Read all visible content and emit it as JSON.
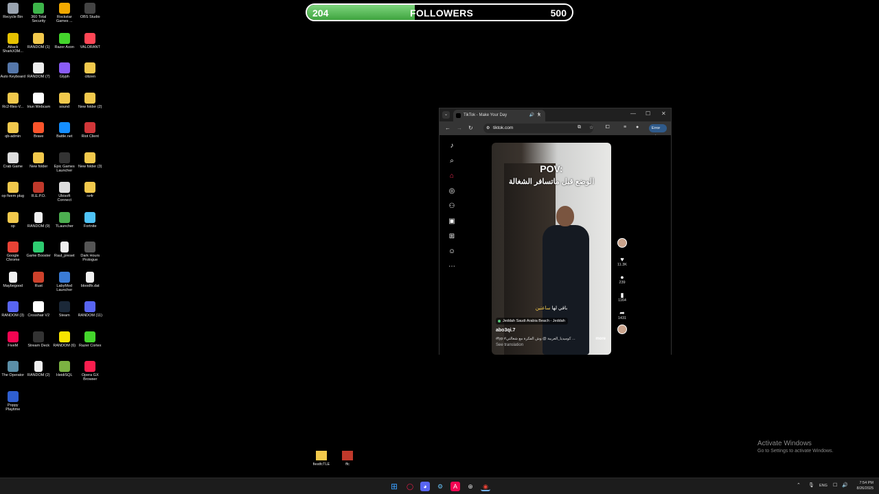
{
  "desktop_icons": [
    {
      "label": "Recycle Bin",
      "color": "#9aa4b0",
      "kind": "app"
    },
    {
      "label": "360 Total Security",
      "color": "#3db54a",
      "kind": "app"
    },
    {
      "label": "Rockstar Games ...",
      "color": "#f2a900",
      "kind": "app"
    },
    {
      "label": "OBS Studio",
      "color": "#444444",
      "kind": "app"
    },
    {
      "label": "Attack SharkX3M...",
      "color": "#e6c200",
      "kind": "app"
    },
    {
      "label": "RANDOM (1)",
      "color": "#f2c94c",
      "kind": "folder"
    },
    {
      "label": "Razer Axon",
      "color": "#44d62c",
      "kind": "app"
    },
    {
      "label": "VALORANT",
      "color": "#ff4655",
      "kind": "app"
    },
    {
      "label": "Auto Keyboard",
      "color": "#5577aa",
      "kind": "app"
    },
    {
      "label": "RANDOM (7)",
      "color": "#eeeeee",
      "kind": "app"
    },
    {
      "label": "Glyph",
      "color": "#8a5cf6",
      "kind": "app"
    },
    {
      "label": "citizen",
      "color": "#f2c94c",
      "kind": "folder"
    },
    {
      "label": "Rc2-files-V...",
      "color": "#f2c94c",
      "kind": "folder"
    },
    {
      "label": "Iriun Webcam",
      "color": "#ffffff",
      "kind": "app"
    },
    {
      "label": "sound",
      "color": "#f2c94c",
      "kind": "folder"
    },
    {
      "label": "New folder (2)",
      "color": "#f2c94c",
      "kind": "folder"
    },
    {
      "label": "qb-admin",
      "color": "#f2c94c",
      "kind": "folder"
    },
    {
      "label": "Brave",
      "color": "#fb542b",
      "kind": "app"
    },
    {
      "label": "Battle.net",
      "color": "#148eff",
      "kind": "app"
    },
    {
      "label": "Riot Client",
      "color": "#d13639",
      "kind": "app"
    },
    {
      "label": "Crab Game",
      "color": "#dddddd",
      "kind": "app"
    },
    {
      "label": "New folder",
      "color": "#f2c94c",
      "kind": "folder"
    },
    {
      "label": "Epic Games Launcher",
      "color": "#333333",
      "kind": "app"
    },
    {
      "label": "New folder (3)",
      "color": "#f2c94c",
      "kind": "folder"
    },
    {
      "label": "op fivem plug",
      "color": "#f2c94c",
      "kind": "folder"
    },
    {
      "label": "R.E.P.O.",
      "color": "#c0392b",
      "kind": "app"
    },
    {
      "label": "Ubisoft Connect",
      "color": "#dddddd",
      "kind": "app"
    },
    {
      "label": "re4r",
      "color": "#f2c94c",
      "kind": "folder"
    },
    {
      "label": "op",
      "color": "#f2c94c",
      "kind": "folder"
    },
    {
      "label": "RANDOM (9)",
      "color": "#f0f0f0",
      "kind": "file"
    },
    {
      "label": "TLauncher",
      "color": "#4caf50",
      "kind": "app"
    },
    {
      "label": "Fortnite",
      "color": "#4fc3f7",
      "kind": "app"
    },
    {
      "label": "Google Chrome",
      "color": "#e94235",
      "kind": "app"
    },
    {
      "label": "Game Booster",
      "color": "#2ecc71",
      "kind": "app"
    },
    {
      "label": "Raul_preset",
      "color": "#f0f0f0",
      "kind": "file"
    },
    {
      "label": "Dark Hours Prologue",
      "color": "#555555",
      "kind": "app"
    },
    {
      "label": "Maybegood",
      "color": "#f0f0f0",
      "kind": "file"
    },
    {
      "label": "Rust",
      "color": "#cd412b",
      "kind": "app"
    },
    {
      "label": "LabyMod Launcher",
      "color": "#3a7bd5",
      "kind": "app"
    },
    {
      "label": "bloodfx.dat",
      "color": "#f0f0f0",
      "kind": "file"
    },
    {
      "label": "RANDOM (3)",
      "color": "#5865f2",
      "kind": "app"
    },
    {
      "label": "Crosshair V2",
      "color": "#ffffff",
      "kind": "app"
    },
    {
      "label": "Steam",
      "color": "#1b2838",
      "kind": "app"
    },
    {
      "label": "RANDOM (11)",
      "color": "#5865f2",
      "kind": "app"
    },
    {
      "label": "FiveM",
      "color": "#f40552",
      "kind": "app"
    },
    {
      "label": "Stream Deck",
      "color": "#333333",
      "kind": "app"
    },
    {
      "label": "RANDOM (6)",
      "color": "#f7e400",
      "kind": "app"
    },
    {
      "label": "Razer Cortex",
      "color": "#44d62c",
      "kind": "app"
    },
    {
      "label": "The Operator",
      "color": "#5b8fa8",
      "kind": "app"
    },
    {
      "label": "RANDOM (2)",
      "color": "#f0f0f0",
      "kind": "file"
    },
    {
      "label": "HeidiSQL",
      "color": "#7cb342",
      "kind": "app"
    },
    {
      "label": "Opera GX Browser",
      "color": "#fa1e4e",
      "kind": "app"
    },
    {
      "label": "Poppy Playtime",
      "color": "#2f5fd0",
      "kind": "app"
    }
  ],
  "followers": {
    "current": "204",
    "title": "FOLLOWERS",
    "goal": "500",
    "progress": 0.408,
    "fill_color": "#4cb84c"
  },
  "browser": {
    "tab_title": "TikTok - Make Your Day",
    "url": "tiktok.com",
    "error_label": "Error"
  },
  "video": {
    "headline": "POV:",
    "arabic_caption": "الوضع قبل ماتسافر الشغالة",
    "subtitle_white": "باقي لها",
    "subtitle_yellow": "ساعتين",
    "location": "Jeddah Saudi Arabia Beach - Jeddah",
    "username": "abo3qi.7",
    "description": "#fyp #كوميديا_العربية @ وش الفكرة مع شغالتي ...",
    "more": "more",
    "see_translation": "See translation",
    "likes": "11.3K",
    "comments": "239",
    "saves": "1164",
    "shares": "1431"
  },
  "bottom_icons": [
    {
      "label": "fiestfcTLE",
      "color": "#f2c94c"
    },
    {
      "label": "ffc",
      "color": "#c0392b"
    }
  ],
  "activate": {
    "line1": "Activate Windows",
    "line2": "Go to Settings to activate Windows."
  },
  "taskbar": {
    "lang": "ENG",
    "time": "7:54 PM",
    "date": "8/26/2025"
  }
}
